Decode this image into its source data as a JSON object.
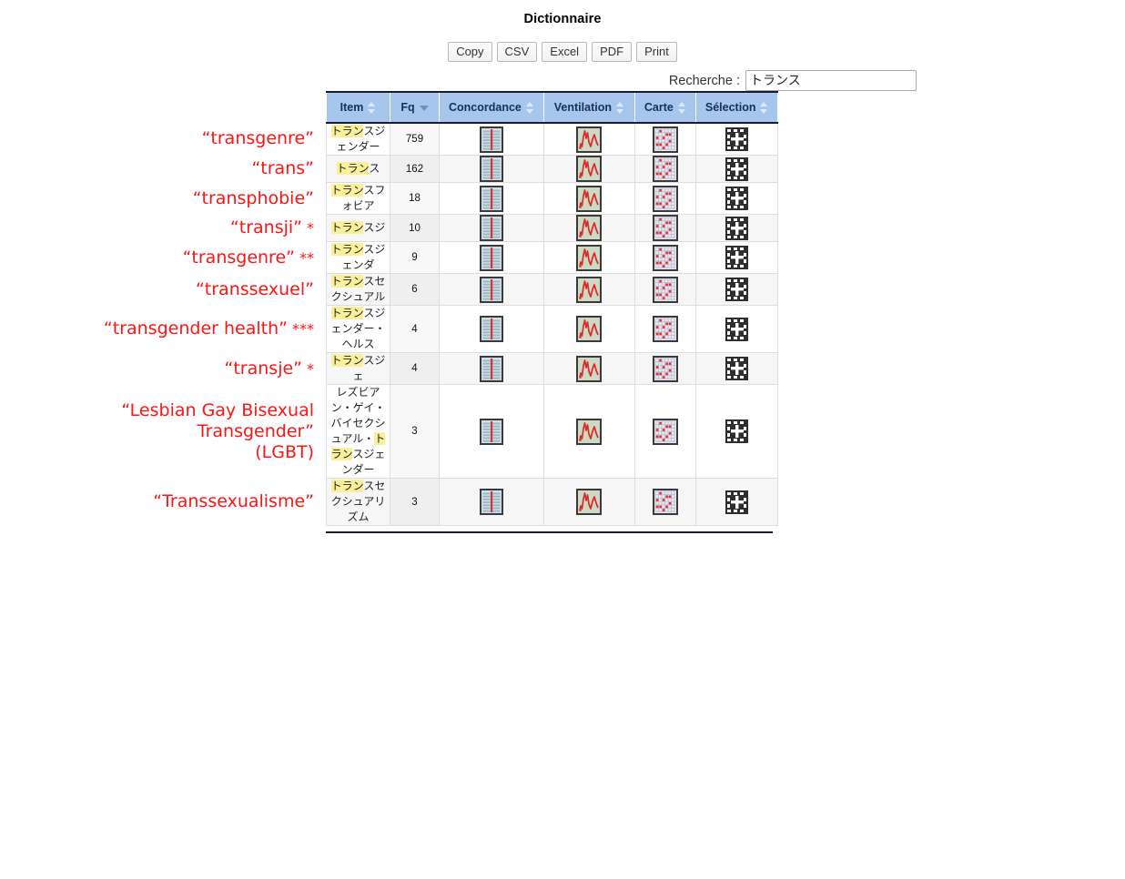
{
  "page": {
    "title": "Dictionnaire"
  },
  "toolbar": {
    "buttons": [
      {
        "label": "Copy",
        "name": "copy-button"
      },
      {
        "label": "CSV",
        "name": "csv-button"
      },
      {
        "label": "Excel",
        "name": "excel-button"
      },
      {
        "label": "PDF",
        "name": "pdf-button"
      },
      {
        "label": "Print",
        "name": "print-button"
      }
    ]
  },
  "search": {
    "label": "Recherche :",
    "value": "トランス",
    "placeholder": ""
  },
  "table": {
    "columns": [
      {
        "label": "Item",
        "sort": "both"
      },
      {
        "label": "Fq",
        "sort": "desc"
      },
      {
        "label": "Concordance",
        "sort": "both"
      },
      {
        "label": "Ventilation",
        "sort": "both"
      },
      {
        "label": "Carte",
        "sort": "both"
      },
      {
        "label": "Sélection",
        "sort": "both"
      }
    ],
    "icons": {
      "concordance": "concordance-icon",
      "ventilation": "ventilation-line-chart-icon",
      "carte": "carte-grid-icon",
      "selection": "selection-plus-icon"
    },
    "rows": [
      {
        "item_highlight": "トラン",
        "item_prefix": "",
        "item_suffix": "スジェンダー",
        "item_full": "トランスジェンダー",
        "fq": "759",
        "annotation": "“transgenre”",
        "stars": ""
      },
      {
        "item_highlight": "トラン",
        "item_prefix": "",
        "item_suffix": "ス",
        "item_full": "トランス",
        "fq": "162",
        "annotation": "“trans”",
        "stars": ""
      },
      {
        "item_highlight": "トラン",
        "item_prefix": "",
        "item_suffix": "スフォビア",
        "item_full": "トランスフォビア",
        "fq": "18",
        "annotation": "“transphobie”",
        "stars": ""
      },
      {
        "item_highlight": "トラン",
        "item_prefix": "",
        "item_suffix": "スジ",
        "item_full": "トランスジ",
        "fq": "10",
        "annotation": "“transji”",
        "stars": "*"
      },
      {
        "item_highlight": "トラン",
        "item_prefix": "",
        "item_suffix": "スジェンダ",
        "item_full": "トランスジェンダ",
        "fq": "9",
        "annotation": "“transgenre”",
        "stars": "**"
      },
      {
        "item_highlight": "トラン",
        "item_prefix": "",
        "item_suffix": "スセクシュアル",
        "item_full": "トランスセクシュアル",
        "fq": "6",
        "annotation": "“transsexuel”",
        "stars": ""
      },
      {
        "item_highlight": "トラン",
        "item_prefix": "",
        "item_suffix": "スジェンダー・ヘルス",
        "item_full": "トランスジェンダー・ヘルス",
        "fq": "4",
        "annotation": "“transgender health”",
        "stars": "***"
      },
      {
        "item_highlight": "トラン",
        "item_prefix": "",
        "item_suffix": "スジェ",
        "item_full": "トランスジェ",
        "fq": "4",
        "annotation": "“transje”",
        "stars": "*"
      },
      {
        "item_highlight": "トラン",
        "item_prefix": "レズビアン・ゲイ・バイセクシュアル・",
        "item_suffix": "スジェンダー",
        "item_full": "レズビアン・ゲイ・バイセクシュアル・トランスジェンダー",
        "fq": "3",
        "annotation": "“Lesbian Gay Bisexual Transgender”\n(LGBT)",
        "stars": ""
      },
      {
        "item_highlight": "トラン",
        "item_prefix": "",
        "item_suffix": "スセクシュアリズム",
        "item_full": "トランスセクシュアリズム",
        "fq": "3",
        "annotation": "“Transsexualisme”",
        "stars": ""
      }
    ]
  },
  "colors": {
    "annotation_red": "#ff1414",
    "header_blue": "#a7c6ed",
    "header_text": "#16305c",
    "highlight_yellow": "#fbf09a"
  }
}
